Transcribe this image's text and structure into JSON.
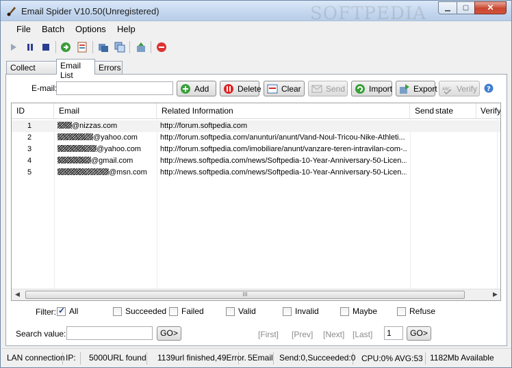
{
  "window": {
    "title": "Email Spider V10.50(Unregistered)",
    "watermark": "SOFTPEDIA"
  },
  "window_controls": {
    "minimize": "▁",
    "maximize": "▢",
    "close": "✕"
  },
  "menu": [
    "File",
    "Batch",
    "Options",
    "Help"
  ],
  "toolbar": {
    "icons": [
      "play-icon",
      "pause-icon",
      "stop-icon",
      "start-url-icon",
      "open-list-icon",
      "export-icon",
      "copy-icon",
      "import-icon",
      "exit-icon"
    ]
  },
  "tabs": [
    "Collect Email",
    "Email List",
    "Errors"
  ],
  "active_tab": "Email List",
  "email_form": {
    "label": "E-mail:",
    "value": ""
  },
  "buttons": {
    "add": "Add",
    "delete": "Delete",
    "clear": "Clear",
    "send": "Send",
    "import": "Import",
    "export": "Export",
    "verify": "Verify"
  },
  "grid": {
    "columns": [
      "ID",
      "Email",
      "Related Information",
      "Send",
      "state",
      "Verify"
    ],
    "rows": [
      {
        "id": "1",
        "email": "@nizzas.com",
        "info": "http://forum.softpedia.com"
      },
      {
        "id": "2",
        "email": "@yahoo.com",
        "info": "http://forum.softpedia.com/anunturi/anunt/Vand-Noul-Tricou-Nike-Athleti..."
      },
      {
        "id": "3",
        "email": "@yahoo.com",
        "info": "http://forum.softpedia.com/imobiliare/anunt/vanzare-teren-intravilan-com-..."
      },
      {
        "id": "4",
        "email": "@gmail.com",
        "info": "http://news.softpedia.com/news/Softpedia-10-Year-Anniversary-50-Licen..."
      },
      {
        "id": "5",
        "email": "@msn.com",
        "info": "http://news.softpedia.com/news/Softpedia-10-Year-Anniversary-50-Licen..."
      }
    ],
    "scroll_grip": "III"
  },
  "filter": {
    "label": "Filter:",
    "options": [
      {
        "label": "All",
        "checked": true
      },
      {
        "label": "Succeeded",
        "checked": false
      },
      {
        "label": "Failed",
        "checked": false
      },
      {
        "label": "Valid",
        "checked": false
      },
      {
        "label": "Invalid",
        "checked": false
      },
      {
        "label": "Maybe",
        "checked": false
      },
      {
        "label": "Refuse",
        "checked": false
      }
    ]
  },
  "search": {
    "label": "Search value:",
    "value": "",
    "go": "GO>"
  },
  "pager": {
    "first": "[First]",
    "prev": "[Prev]",
    "next": "[Next]",
    "last": "[Last]",
    "page": "1",
    "go": "GO>"
  },
  "status": {
    "lan": "LAN connection",
    "ip": "IP:",
    "urls_found": "5000URL found",
    "progress": "1139url finished,49Error.",
    "emails": "5Email",
    "send": "Send:0,Succeeded:0",
    "cpu": "CPU:0% AVG:53",
    "memory": "1182Mb Available"
  },
  "colors": {
    "title_bar": "#c3d6ee",
    "close_button": "#c9462f",
    "panel": "#f0f0f0"
  }
}
